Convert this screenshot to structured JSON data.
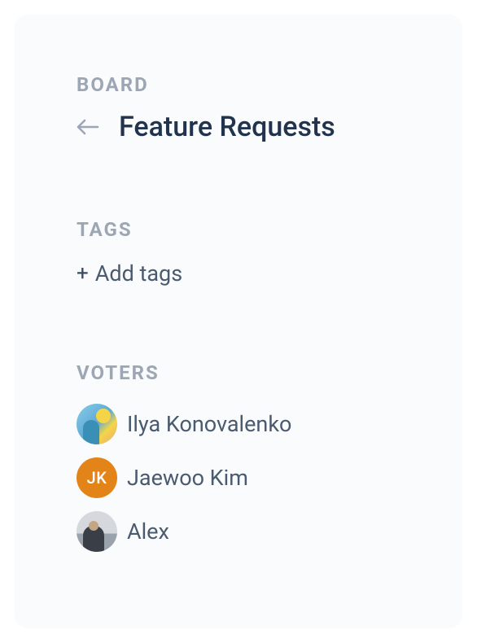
{
  "sections": {
    "board": {
      "label": "BOARD",
      "name": "Feature Requests"
    },
    "tags": {
      "label": "TAGS",
      "add_label": "Add tags"
    },
    "voters": {
      "label": "VOTERS",
      "list": [
        {
          "name": "Ilya Konovalenko",
          "initials": "",
          "avatar_type": "image"
        },
        {
          "name": "Jaewoo Kim",
          "initials": "JK",
          "avatar_type": "initials",
          "color": "#e28418"
        },
        {
          "name": "Alex",
          "initials": "",
          "avatar_type": "image"
        }
      ]
    }
  }
}
